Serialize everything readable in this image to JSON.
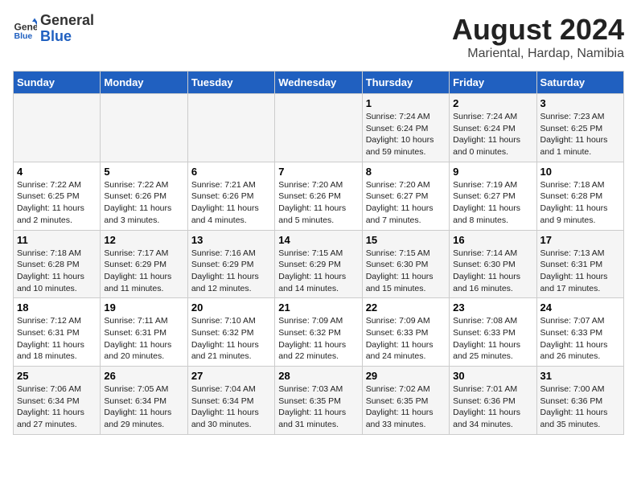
{
  "header": {
    "logo_line1": "General",
    "logo_line2": "Blue",
    "month_year": "August 2024",
    "location": "Mariental, Hardap, Namibia"
  },
  "days_of_week": [
    "Sunday",
    "Monday",
    "Tuesday",
    "Wednesday",
    "Thursday",
    "Friday",
    "Saturday"
  ],
  "weeks": [
    [
      {
        "day": "",
        "info": ""
      },
      {
        "day": "",
        "info": ""
      },
      {
        "day": "",
        "info": ""
      },
      {
        "day": "",
        "info": ""
      },
      {
        "day": "1",
        "info": "Sunrise: 7:24 AM\nSunset: 6:24 PM\nDaylight: 10 hours\nand 59 minutes."
      },
      {
        "day": "2",
        "info": "Sunrise: 7:24 AM\nSunset: 6:24 PM\nDaylight: 11 hours\nand 0 minutes."
      },
      {
        "day": "3",
        "info": "Sunrise: 7:23 AM\nSunset: 6:25 PM\nDaylight: 11 hours\nand 1 minute."
      }
    ],
    [
      {
        "day": "4",
        "info": "Sunrise: 7:22 AM\nSunset: 6:25 PM\nDaylight: 11 hours\nand 2 minutes."
      },
      {
        "day": "5",
        "info": "Sunrise: 7:22 AM\nSunset: 6:26 PM\nDaylight: 11 hours\nand 3 minutes."
      },
      {
        "day": "6",
        "info": "Sunrise: 7:21 AM\nSunset: 6:26 PM\nDaylight: 11 hours\nand 4 minutes."
      },
      {
        "day": "7",
        "info": "Sunrise: 7:20 AM\nSunset: 6:26 PM\nDaylight: 11 hours\nand 5 minutes."
      },
      {
        "day": "8",
        "info": "Sunrise: 7:20 AM\nSunset: 6:27 PM\nDaylight: 11 hours\nand 7 minutes."
      },
      {
        "day": "9",
        "info": "Sunrise: 7:19 AM\nSunset: 6:27 PM\nDaylight: 11 hours\nand 8 minutes."
      },
      {
        "day": "10",
        "info": "Sunrise: 7:18 AM\nSunset: 6:28 PM\nDaylight: 11 hours\nand 9 minutes."
      }
    ],
    [
      {
        "day": "11",
        "info": "Sunrise: 7:18 AM\nSunset: 6:28 PM\nDaylight: 11 hours\nand 10 minutes."
      },
      {
        "day": "12",
        "info": "Sunrise: 7:17 AM\nSunset: 6:29 PM\nDaylight: 11 hours\nand 11 minutes."
      },
      {
        "day": "13",
        "info": "Sunrise: 7:16 AM\nSunset: 6:29 PM\nDaylight: 11 hours\nand 12 minutes."
      },
      {
        "day": "14",
        "info": "Sunrise: 7:15 AM\nSunset: 6:29 PM\nDaylight: 11 hours\nand 14 minutes."
      },
      {
        "day": "15",
        "info": "Sunrise: 7:15 AM\nSunset: 6:30 PM\nDaylight: 11 hours\nand 15 minutes."
      },
      {
        "day": "16",
        "info": "Sunrise: 7:14 AM\nSunset: 6:30 PM\nDaylight: 11 hours\nand 16 minutes."
      },
      {
        "day": "17",
        "info": "Sunrise: 7:13 AM\nSunset: 6:31 PM\nDaylight: 11 hours\nand 17 minutes."
      }
    ],
    [
      {
        "day": "18",
        "info": "Sunrise: 7:12 AM\nSunset: 6:31 PM\nDaylight: 11 hours\nand 18 minutes."
      },
      {
        "day": "19",
        "info": "Sunrise: 7:11 AM\nSunset: 6:31 PM\nDaylight: 11 hours\nand 20 minutes."
      },
      {
        "day": "20",
        "info": "Sunrise: 7:10 AM\nSunset: 6:32 PM\nDaylight: 11 hours\nand 21 minutes."
      },
      {
        "day": "21",
        "info": "Sunrise: 7:09 AM\nSunset: 6:32 PM\nDaylight: 11 hours\nand 22 minutes."
      },
      {
        "day": "22",
        "info": "Sunrise: 7:09 AM\nSunset: 6:33 PM\nDaylight: 11 hours\nand 24 minutes."
      },
      {
        "day": "23",
        "info": "Sunrise: 7:08 AM\nSunset: 6:33 PM\nDaylight: 11 hours\nand 25 minutes."
      },
      {
        "day": "24",
        "info": "Sunrise: 7:07 AM\nSunset: 6:33 PM\nDaylight: 11 hours\nand 26 minutes."
      }
    ],
    [
      {
        "day": "25",
        "info": "Sunrise: 7:06 AM\nSunset: 6:34 PM\nDaylight: 11 hours\nand 27 minutes."
      },
      {
        "day": "26",
        "info": "Sunrise: 7:05 AM\nSunset: 6:34 PM\nDaylight: 11 hours\nand 29 minutes."
      },
      {
        "day": "27",
        "info": "Sunrise: 7:04 AM\nSunset: 6:34 PM\nDaylight: 11 hours\nand 30 minutes."
      },
      {
        "day": "28",
        "info": "Sunrise: 7:03 AM\nSunset: 6:35 PM\nDaylight: 11 hours\nand 31 minutes."
      },
      {
        "day": "29",
        "info": "Sunrise: 7:02 AM\nSunset: 6:35 PM\nDaylight: 11 hours\nand 33 minutes."
      },
      {
        "day": "30",
        "info": "Sunrise: 7:01 AM\nSunset: 6:36 PM\nDaylight: 11 hours\nand 34 minutes."
      },
      {
        "day": "31",
        "info": "Sunrise: 7:00 AM\nSunset: 6:36 PM\nDaylight: 11 hours\nand 35 minutes."
      }
    ]
  ]
}
